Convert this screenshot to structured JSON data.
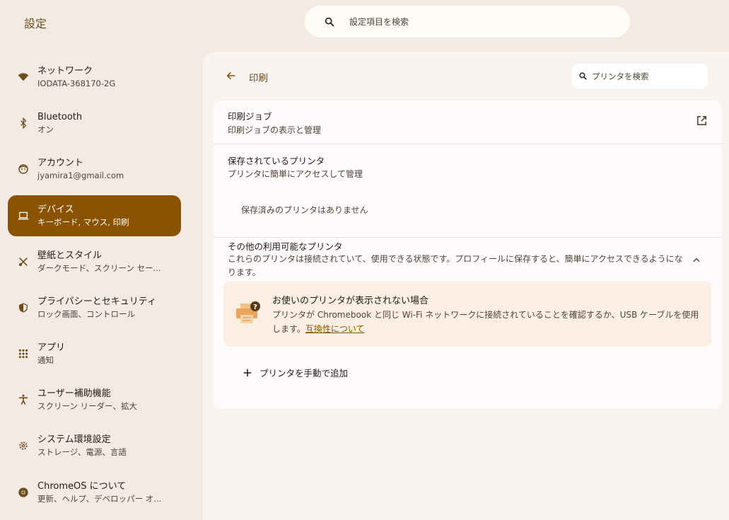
{
  "app": {
    "title": "設定"
  },
  "top_search": {
    "placeholder": "設定項目を検索",
    "icon": "search-icon"
  },
  "sidebar": {
    "items": [
      {
        "id": "network",
        "label": "ネットワーク",
        "sub": "IODATA-368170-2G",
        "icon": "wifi-icon"
      },
      {
        "id": "bluetooth",
        "label": "Bluetooth",
        "sub": "オン",
        "icon": "bluetooth-icon"
      },
      {
        "id": "account",
        "label": "アカウント",
        "sub": "jyamira1@gmail.com",
        "icon": "account-face-icon"
      },
      {
        "id": "device",
        "label": "デバイス",
        "sub": "キーボード, マウス, 印刷",
        "icon": "laptop-icon",
        "active": true
      },
      {
        "id": "wallpaper",
        "label": "壁紙とスタイル",
        "sub": "ダークモード、スクリーン セー...",
        "icon": "paintbrush-icon"
      },
      {
        "id": "privacy",
        "label": "プライバシーとセキュリティ",
        "sub": "ロック画面、コントロール",
        "icon": "shield-icon"
      },
      {
        "id": "apps",
        "label": "アプリ",
        "sub": "通知",
        "icon": "grid-icon"
      },
      {
        "id": "accessibility",
        "label": "ユーザー補助機能",
        "sub": "スクリーン リーダー、拡大",
        "icon": "accessibility-icon"
      },
      {
        "id": "system",
        "label": "システム環境設定",
        "sub": "ストレージ、電源、言語",
        "icon": "gear-icon"
      },
      {
        "id": "about",
        "label": "ChromeOS について",
        "sub": "更新、ヘルプ、デベロッパー オ...",
        "icon": "chrome-icon"
      }
    ]
  },
  "page": {
    "title": "印刷",
    "search_placeholder": "プリンタを検索"
  },
  "print_jobs": {
    "title": "印刷ジョブ",
    "sub": "印刷ジョブの表示と管理"
  },
  "saved_printers": {
    "title": "保存されているプリンタ",
    "sub": "プリンタに簡単にアクセスして管理",
    "empty": "保存済みのプリンタはありません"
  },
  "other_printers": {
    "title": "その他の利用可能なプリンタ",
    "desc": "これらのプリンタは接続されていて、使用できる状態です。プロフィールに保存すると、簡単にアクセスできるようになります。"
  },
  "notice": {
    "title": "お使いのプリンタが表示されない場合",
    "body": "プリンタが Chromebook と同じ Wi-Fi ネットワークに接続されていることを確認するか、USB ケーブルを使用します。",
    "link": "互換性について"
  },
  "add_printer": {
    "label": "プリンタを手動で追加"
  },
  "colors": {
    "accent": "#8a5300",
    "background": "#f3ebe3",
    "panel": "#f9f3f0",
    "card": "#fffbfc",
    "notice": "#fbeee2"
  }
}
